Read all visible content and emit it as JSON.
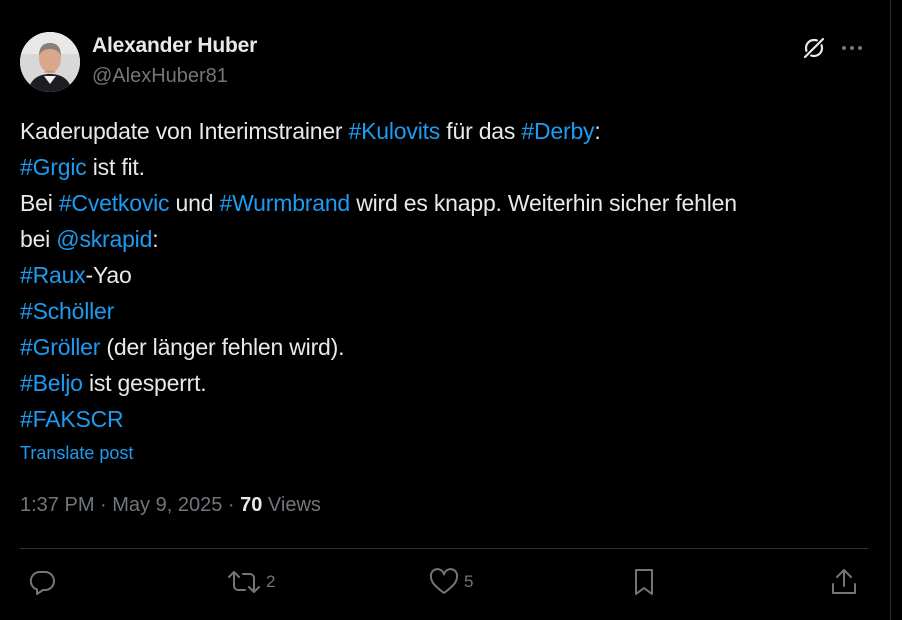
{
  "author": {
    "name": "Alexander Huber",
    "handle": "@AlexHuber81"
  },
  "tweet": {
    "lines": [
      [
        {
          "t": "Kaderupdate von Interimstrainer ",
          "link": false
        },
        {
          "t": "#Kulovits",
          "link": true
        },
        {
          "t": " für das ",
          "link": false
        },
        {
          "t": "#Derby",
          "link": true
        },
        {
          "t": ":",
          "link": false
        }
      ],
      [
        {
          "t": "#Grgic",
          "link": true
        },
        {
          "t": " ist fit.",
          "link": false
        }
      ],
      [
        {
          "t": "Bei ",
          "link": false
        },
        {
          "t": "#Cvetkovic",
          "link": true
        },
        {
          "t": " und ",
          "link": false
        },
        {
          "t": "#Wurmbrand",
          "link": true
        },
        {
          "t": " wird es knapp. Weiterhin sicher fehlen",
          "link": false
        }
      ],
      [
        {
          "t": "bei ",
          "link": false
        },
        {
          "t": "@skrapid",
          "link": true
        },
        {
          "t": ":",
          "link": false
        }
      ],
      [
        {
          "t": "#Raux",
          "link": true
        },
        {
          "t": "-Yao",
          "link": false
        }
      ],
      [
        {
          "t": "#Schöller",
          "link": true
        }
      ],
      [
        {
          "t": "#Gröller",
          "link": true
        },
        {
          "t": " (der länger fehlen wird).",
          "link": false
        }
      ],
      [
        {
          "t": "#Beljo",
          "link": true
        },
        {
          "t": " ist gesperrt.",
          "link": false
        }
      ],
      [
        {
          "t": "#FAKSCR",
          "link": true
        }
      ]
    ],
    "translate_label": "Translate post"
  },
  "meta": {
    "time": "1:37 PM",
    "dot1": " · ",
    "date": "May 9, 2025",
    "dot2": " · ",
    "views_count": "70",
    "views_label": " Views"
  },
  "actions": {
    "reply_count": "",
    "repost_count": "2",
    "like_count": "5"
  },
  "icons": {
    "header": [
      "grok-icon",
      "more-icon"
    ],
    "actions": [
      "reply-icon",
      "repost-icon",
      "like-icon",
      "bookmark-icon",
      "share-icon"
    ]
  },
  "colors": {
    "link": "#1d9bf0",
    "text": "#e7e9ea",
    "muted": "#71767b",
    "background": "#000000"
  }
}
